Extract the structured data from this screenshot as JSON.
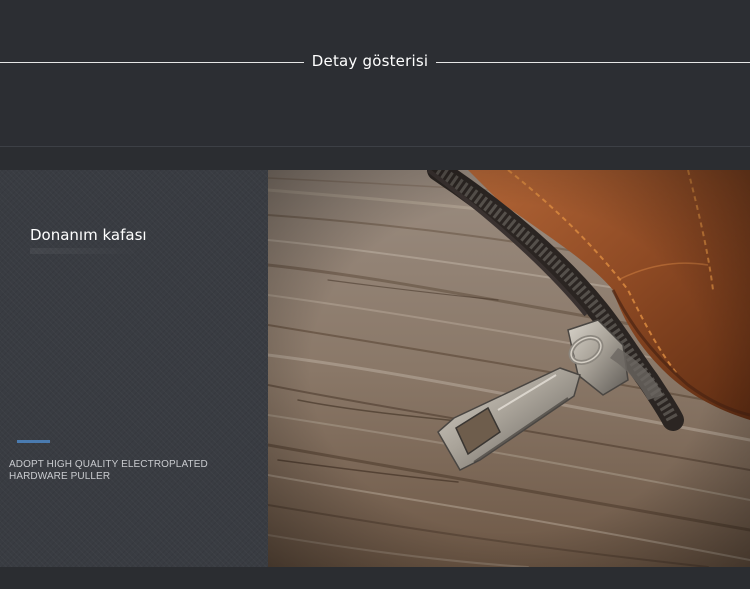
{
  "header": {
    "title": "Detay gösterisi"
  },
  "feature": {
    "title": "Donanım kafası",
    "description_line1": "ADOPT HIGH QUALITY ELECTROPLATED",
    "description_line2": "HARDWARE PULLER"
  },
  "colors": {
    "background": "#2b2d31",
    "panel": "#393c42",
    "accent": "#4a7bb0",
    "leather": "#8a4420",
    "wood": "#8a7a6b",
    "zipper_metal": "#b2aca2"
  },
  "photo": {
    "icon": "wallet-zipper-closeup-photo"
  }
}
